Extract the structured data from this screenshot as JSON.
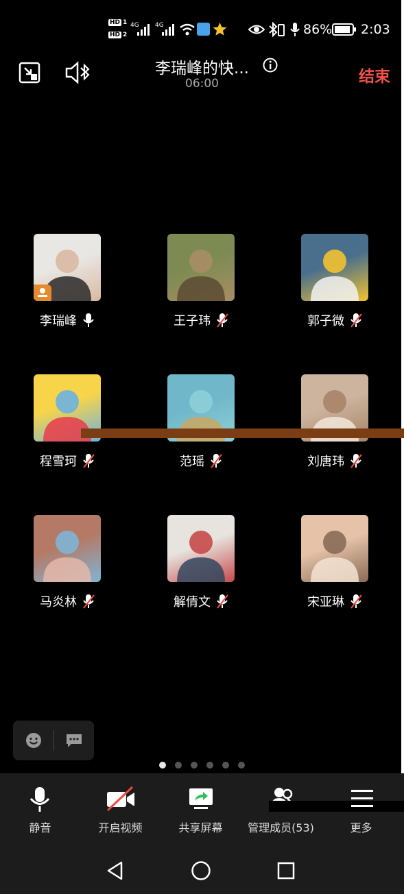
{
  "status_bar": {
    "hd1": "HD",
    "hd1_num": "1",
    "hd2": "HD",
    "hd2_num": "2",
    "net1": "4G",
    "net2": "4G",
    "battery": "86%",
    "time": "2:03"
  },
  "header": {
    "title": "李瑞峰的快...",
    "timer": "06:00",
    "end_label": "结束"
  },
  "participants": [
    {
      "name": "李瑞峰",
      "mic": "on",
      "host": true
    },
    {
      "name": "王子玮",
      "mic": "muted"
    },
    {
      "name": "郭子微",
      "mic": "muted"
    },
    {
      "name": "程雪珂",
      "mic": "muted"
    },
    {
      "name": "范瑶",
      "mic": "muted"
    },
    {
      "name": "刘唐玮",
      "mic": "muted"
    },
    {
      "name": "马炎林",
      "mic": "muted"
    },
    {
      "name": "解倩文",
      "mic": "muted"
    },
    {
      "name": "宋亚琳",
      "mic": "muted"
    }
  ],
  "pages": {
    "total": 6,
    "current": 1
  },
  "toolbar": {
    "mute": "静音",
    "video": "开启视频",
    "share": "共享屏幕",
    "members": "管理成员(53)",
    "more": "更多"
  },
  "colors": {
    "accent_end": "#f0514b",
    "host_badge": "#e68a2e",
    "share_green": "#2fbf5a"
  }
}
